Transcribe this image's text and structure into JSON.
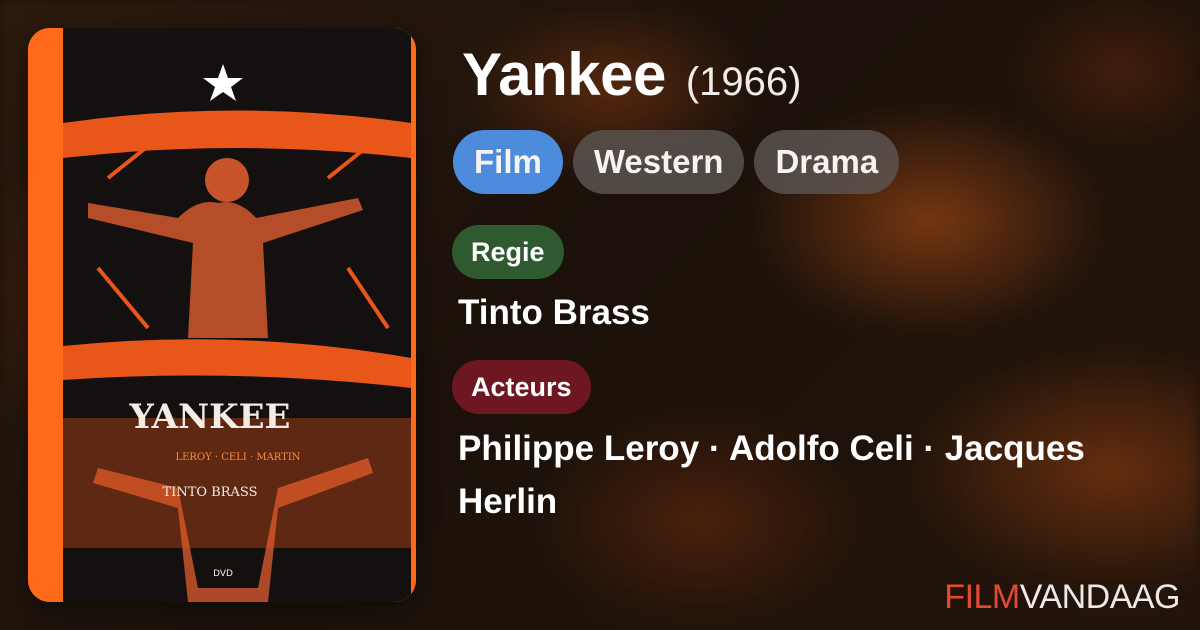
{
  "poster": {
    "title_text": "YANKEE",
    "director_text": "TINTO BRASS",
    "cast_text": "LEROY · CELI · MARTIN",
    "format_text": "DVD"
  },
  "movie": {
    "title": "Yankee",
    "year": "(1966)"
  },
  "genres": [
    "Film",
    "Western",
    "Drama"
  ],
  "director": {
    "label": "Regie",
    "name": "Tinto Brass"
  },
  "cast": {
    "label": "Acteurs",
    "names": "Philippe Leroy · Adolfo Celi · Jacques Herlin"
  },
  "brand": {
    "part1": "FILM",
    "part2": "VANDAAG"
  },
  "colors": {
    "film_chip": "#4d8bdc",
    "regie_label": "#2f5a2f",
    "acteurs_label": "#6e1722",
    "brand_accent": "#e24a33",
    "poster_orange": "#ff6a1a"
  }
}
